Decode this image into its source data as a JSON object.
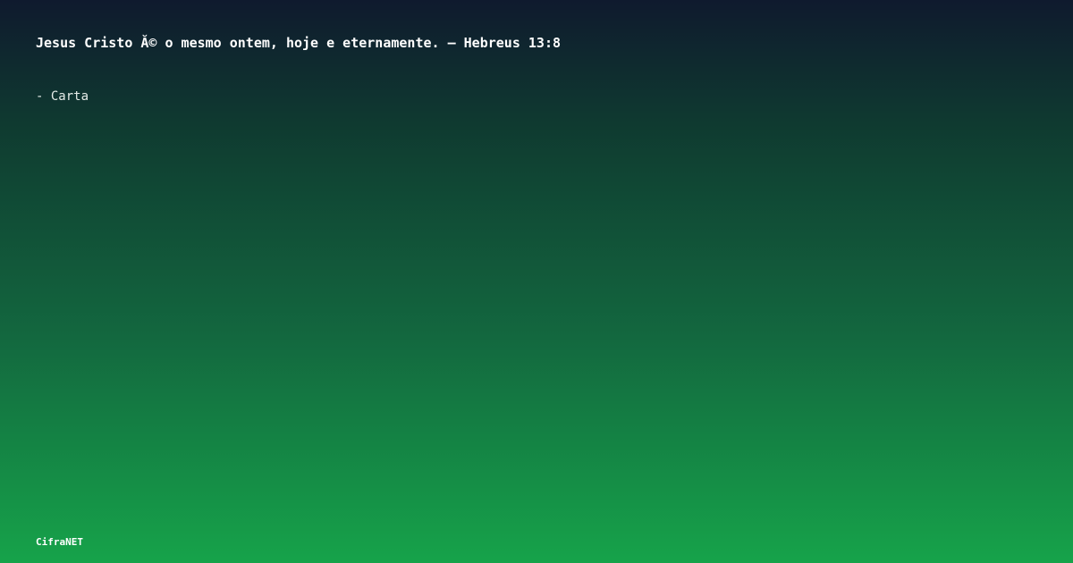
{
  "title": "Jesus Cristo Ă© o mesmo ontem, hoje e eternamente. — Hebreus 13:8",
  "subtitle": "- Carta",
  "brand": "CifraNET",
  "colors": {
    "gradient_top": "#0f1a2e",
    "gradient_bottom": "#16a34a",
    "text": "#ffffff"
  }
}
